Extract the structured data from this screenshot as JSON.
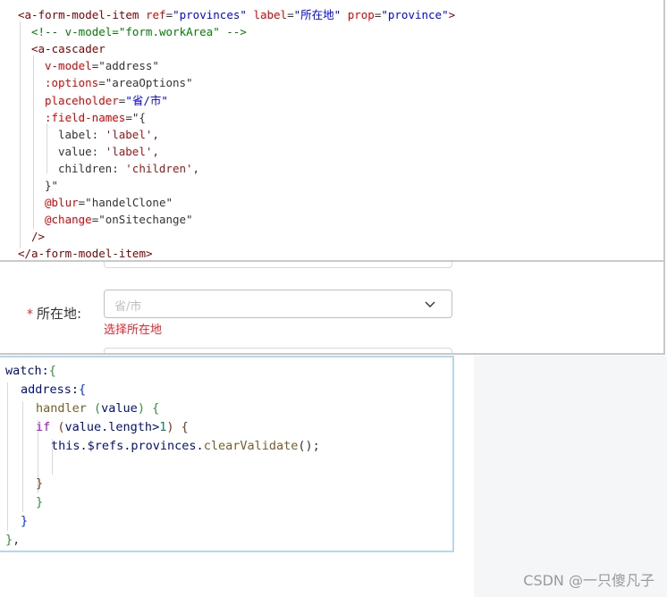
{
  "code_top": {
    "lines": [
      {
        "parts": [
          {
            "t": "<a-form-model-item ",
            "c": "tag"
          },
          {
            "t": "ref",
            "c": "attr"
          },
          {
            "t": "=",
            "c": "plain"
          },
          {
            "t": "\"provinces\"",
            "c": "str"
          },
          {
            "t": " ",
            "c": "plain"
          },
          {
            "t": "label",
            "c": "attr"
          },
          {
            "t": "=",
            "c": "plain"
          },
          {
            "t": "\"所在地\"",
            "c": "str"
          },
          {
            "t": " ",
            "c": "plain"
          },
          {
            "t": "prop",
            "c": "attr"
          },
          {
            "t": "=",
            "c": "plain"
          },
          {
            "t": "\"province\"",
            "c": "str"
          },
          {
            "t": ">",
            "c": "tag"
          }
        ]
      },
      {
        "parts": [
          {
            "t": "<!-- v-model=\"form.workArea\" -->",
            "c": "cmt"
          }
        ]
      },
      {
        "parts": [
          {
            "t": "<a-cascader",
            "c": "tag"
          }
        ]
      },
      {
        "parts": [
          {
            "t": "v-model",
            "c": "attr"
          },
          {
            "t": "=",
            "c": "plain"
          },
          {
            "t": "\"address\"",
            "c": "plain"
          }
        ]
      },
      {
        "parts": [
          {
            "t": ":options",
            "c": "attr"
          },
          {
            "t": "=",
            "c": "plain"
          },
          {
            "t": "\"areaOptions\"",
            "c": "plain"
          }
        ]
      },
      {
        "parts": [
          {
            "t": "placeholder",
            "c": "attr"
          },
          {
            "t": "=",
            "c": "plain"
          },
          {
            "t": "\"省/市\"",
            "c": "str"
          }
        ]
      },
      {
        "parts": [
          {
            "t": ":field-names",
            "c": "attr"
          },
          {
            "t": "=",
            "c": "plain"
          },
          {
            "t": "\"{",
            "c": "plain"
          }
        ]
      },
      {
        "parts": [
          {
            "t": "label: ",
            "c": "plain"
          },
          {
            "t": "'label'",
            "c": "sq"
          },
          {
            "t": ",",
            "c": "plain"
          }
        ]
      },
      {
        "parts": [
          {
            "t": "value: ",
            "c": "plain"
          },
          {
            "t": "'label'",
            "c": "sq"
          },
          {
            "t": ",",
            "c": "plain"
          }
        ]
      },
      {
        "parts": [
          {
            "t": "children: ",
            "c": "plain"
          },
          {
            "t": "'children'",
            "c": "sq"
          },
          {
            "t": ",",
            "c": "plain"
          }
        ]
      },
      {
        "parts": [
          {
            "t": "}\"",
            "c": "plain"
          }
        ]
      },
      {
        "parts": [
          {
            "t": "@blur",
            "c": "attr"
          },
          {
            "t": "=",
            "c": "plain"
          },
          {
            "t": "\"handelClone\"",
            "c": "plain"
          }
        ]
      },
      {
        "parts": [
          {
            "t": "@change",
            "c": "attr"
          },
          {
            "t": "=",
            "c": "plain"
          },
          {
            "t": "\"onSitechange\"",
            "c": "plain"
          }
        ]
      },
      {
        "parts": [
          {
            "t": "/>",
            "c": "tag"
          }
        ]
      },
      {
        "parts": [
          {
            "t": "</a-form-model-item>",
            "c": "tag"
          }
        ]
      }
    ]
  },
  "form": {
    "required_mark": "*",
    "label": "所在地:",
    "cascader_placeholder": "省/市",
    "error_text": "选择所在地",
    "chevron_icon": "chevron-down-icon"
  },
  "code_bottom": {
    "lines": [
      {
        "parts": [
          {
            "t": "watch:",
            "c": "var"
          },
          {
            "t": "{",
            "c": "brk2"
          }
        ]
      },
      {
        "parts": [
          {
            "t": "address:",
            "c": "var"
          },
          {
            "t": "{",
            "c": "brk1"
          }
        ]
      },
      {
        "parts": [
          {
            "t": "handler ",
            "c": "fn"
          },
          {
            "t": "(",
            "c": "brk2"
          },
          {
            "t": "value",
            "c": "var"
          },
          {
            "t": ")",
            "c": "brk2"
          },
          {
            "t": " {",
            "c": "brk2"
          }
        ]
      },
      {
        "parts": [
          {
            "t": "if ",
            "c": "kw"
          },
          {
            "t": "(",
            "c": "brk3"
          },
          {
            "t": "value.length>",
            "c": "var"
          },
          {
            "t": "1",
            "c": "num"
          },
          {
            "t": ")",
            "c": "brk3"
          },
          {
            "t": " {",
            "c": "brk3"
          }
        ]
      },
      {
        "parts": [
          {
            "t": "this.$refs.provinces.",
            "c": "var"
          },
          {
            "t": "clearValidate",
            "c": "fn"
          },
          {
            "t": "();",
            "c": "plain"
          }
        ]
      },
      {
        "parts": []
      },
      {
        "parts": [
          {
            "t": "}",
            "c": "brk3"
          }
        ]
      },
      {
        "parts": [
          {
            "t": "}",
            "c": "brk2"
          }
        ]
      },
      {
        "parts": [
          {
            "t": "}",
            "c": "brk1"
          }
        ]
      },
      {
        "parts": [
          {
            "t": "}",
            "c": "brk2"
          },
          {
            "t": ",",
            "c": "plain"
          }
        ]
      }
    ]
  },
  "watermark": "CSDN @一只傻凡子"
}
